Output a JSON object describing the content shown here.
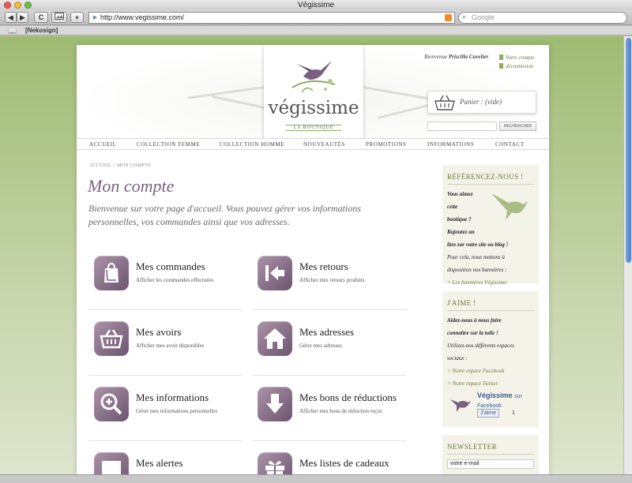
{
  "browser": {
    "window_title": "Végissime",
    "url": "http://www.vegissime.com/",
    "search_placeholder": "Google",
    "bookmark": "[Nekosign]",
    "buttons": {
      "back": "◀",
      "forward": "▶",
      "reload": "C",
      "add": "+"
    }
  },
  "header": {
    "brand": "végissime",
    "tagline": "LA BOUTIQUE",
    "welcome_prefix": "Bienvenue",
    "user_name": "Priscilla Cuvelier",
    "account_link": "Votre compte",
    "logout_link": "déconnexion",
    "cart_label": "Panier : (vide)",
    "search_button": "RECHERCHER"
  },
  "nav": [
    "ACCUEIL",
    "COLLECTION FEMME",
    "COLLECTION HOMME",
    "NOUVEAUTÉS",
    "PROMOTIONS",
    "INFORMATIONS",
    "CONTACT"
  ],
  "breadcrumb": "ACCUEIL > MON COMPTE",
  "main": {
    "title": "Mon compte",
    "intro": "Bienvenue sur votre page d'accueil. Vous pouvez gérer vos informations personnelles, vos commandes ainsi que vos adresses.",
    "tiles": [
      {
        "title": "Mes commandes",
        "desc": "Afficher les commandes effectuées",
        "icon": "shopping-bag-icon"
      },
      {
        "title": "Mes retours",
        "desc": "Afficher mes retours produits",
        "icon": "return-arrow-icon"
      },
      {
        "title": "Mes avoirs",
        "desc": "Afficher mes avoir disponibles",
        "icon": "basket-icon"
      },
      {
        "title": "Mes adresses",
        "desc": "Gérer mes adresses",
        "icon": "house-icon"
      },
      {
        "title": "Mes informations",
        "desc": "Gérer mes informations personnelles",
        "icon": "magnifier-plus-icon"
      },
      {
        "title": "Mes bons de réductions",
        "desc": "Afficher mes bons de réduction reçus",
        "icon": "down-arrow-icon"
      },
      {
        "title": "Mes alertes",
        "desc": "",
        "icon": "speech-bubble-icon"
      },
      {
        "title": "Mes listes de cadeaux",
        "desc": "",
        "icon": "gift-icon"
      }
    ]
  },
  "sidebar": {
    "refer": {
      "heading": "RÉFÉRENCEZ-NOUS !",
      "lines_bold": [
        "Vous aimez",
        "cette",
        "boutique ?",
        "Rajoutez un",
        "lien sur votre site ou blog !"
      ],
      "lines_italic": [
        "Pour cela, nous mettons à",
        "disposition nos bannières :"
      ],
      "link": "> Les bannières Végissime"
    },
    "like": {
      "heading": "J'AIME !",
      "lines_bold": [
        "Aidez-nous à nous faire",
        "connaître sur la toile !"
      ],
      "lines_italic": [
        "Utilisez-nos différents espaces",
        "sociaux :"
      ],
      "links": [
        "> Notre espace Facebook",
        "> Notre espace Twitter"
      ],
      "fb_name": "Végissime",
      "fb_suffix": "sur Facebook",
      "fb_like": "J'aime",
      "fb_count": "1",
      "fb_logo_text": "végissime"
    },
    "newsletter": {
      "heading": "NEWSLETTER",
      "input_value": "votre e-mail"
    }
  },
  "colors": {
    "accent": "#7a607f",
    "green": "#6a7a3a",
    "icon_top": "#ab93a8",
    "icon_bottom": "#6d5470"
  }
}
